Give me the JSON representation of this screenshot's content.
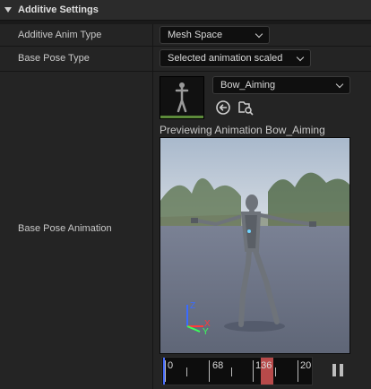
{
  "section": {
    "title": "Additive Settings"
  },
  "rows": {
    "additive_anim_type": {
      "label": "Additive Anim Type",
      "value": "Mesh Space"
    },
    "base_pose_type": {
      "label": "Base Pose Type",
      "value": "Selected animation scaled"
    },
    "base_pose_animation": {
      "label": "Base Pose Animation",
      "asset": "Bow_Aiming"
    }
  },
  "preview": {
    "text": "Previewing Animation Bow_Aiming"
  },
  "timeline": {
    "labels": [
      "0",
      "68",
      "136",
      "20"
    ],
    "playhead_frame": 136
  },
  "icons": {
    "use_selected": "arrow-left-circle-icon",
    "browse": "folder-search-icon",
    "pause": "pause-icon"
  },
  "colors": {
    "accent": "#4a6fff",
    "playhead": "#b84a4a",
    "thumb_bar": "#5c8a3a"
  }
}
